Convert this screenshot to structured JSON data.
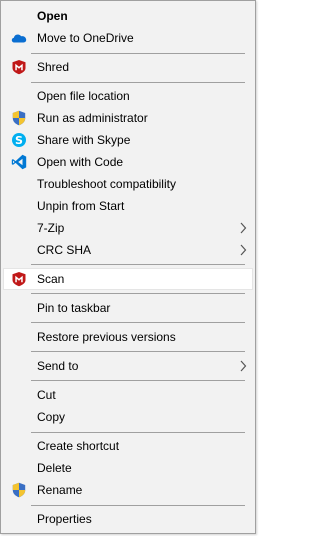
{
  "menu": {
    "items": [
      {
        "label": "Open",
        "icon": null,
        "submenu": false,
        "bold": true
      },
      {
        "label": "Move to OneDrive",
        "icon": "onedrive-icon",
        "submenu": false
      },
      {
        "label": "Shred",
        "icon": "mcafee-icon",
        "submenu": false
      },
      {
        "label": "Open file location",
        "icon": null,
        "submenu": false
      },
      {
        "label": "Run as administrator",
        "icon": "uac-shield-icon",
        "submenu": false
      },
      {
        "label": "Share with Skype",
        "icon": "skype-icon",
        "submenu": false
      },
      {
        "label": "Open with Code",
        "icon": "vscode-icon",
        "submenu": false
      },
      {
        "label": "Troubleshoot compatibility",
        "icon": null,
        "submenu": false
      },
      {
        "label": "Unpin from Start",
        "icon": null,
        "submenu": false
      },
      {
        "label": "7-Zip",
        "icon": null,
        "submenu": true
      },
      {
        "label": "CRC SHA",
        "icon": null,
        "submenu": true
      },
      {
        "label": "Scan",
        "icon": "mcafee-icon",
        "submenu": false,
        "highlighted": true
      },
      {
        "label": "Pin to taskbar",
        "icon": null,
        "submenu": false
      },
      {
        "label": "Restore previous versions",
        "icon": null,
        "submenu": false
      },
      {
        "label": "Send to",
        "icon": null,
        "submenu": true
      },
      {
        "label": "Cut",
        "icon": null,
        "submenu": false
      },
      {
        "label": "Copy",
        "icon": null,
        "submenu": false
      },
      {
        "label": "Create shortcut",
        "icon": null,
        "submenu": false
      },
      {
        "label": "Delete",
        "icon": null,
        "submenu": false
      },
      {
        "label": "Rename",
        "icon": "uac-shield-icon",
        "submenu": false
      },
      {
        "label": "Properties",
        "icon": null,
        "submenu": false
      }
    ]
  },
  "colors": {
    "menu_background": "#f2f2f2",
    "separator": "#a0a0a0",
    "highlight_background": "#ffffff",
    "onedrive_blue": "#0a6ed1",
    "mcafee_red": "#c01818",
    "skype_blue": "#00aff0",
    "vscode_blue": "#0078d4"
  }
}
